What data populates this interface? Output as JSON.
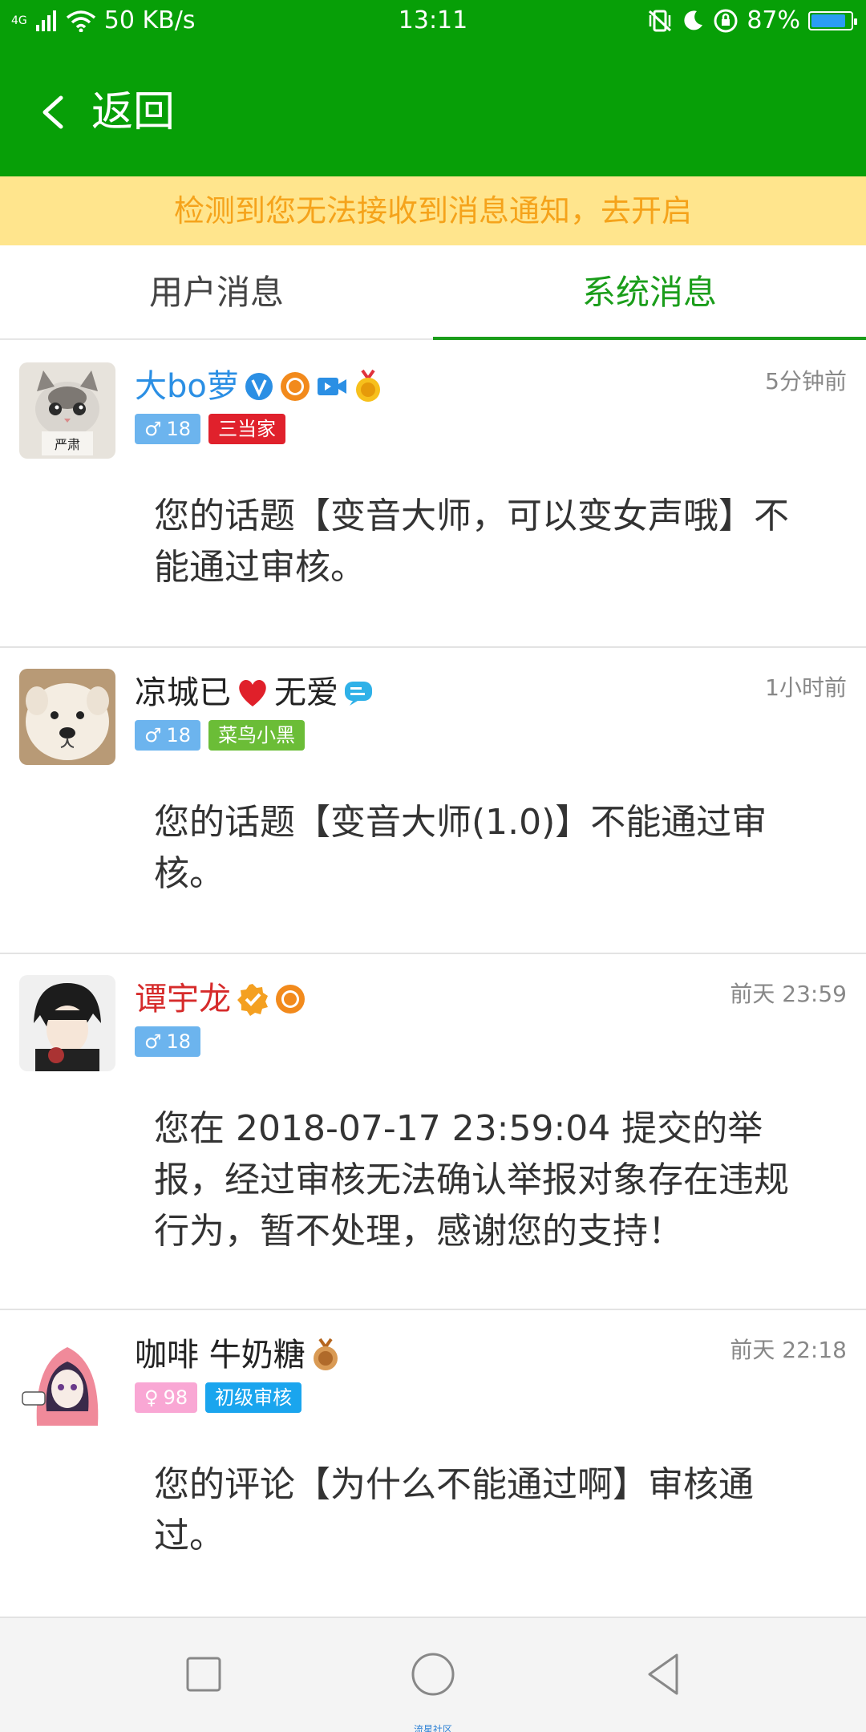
{
  "status_bar": {
    "network": "4G",
    "speed": "50 KB/s",
    "time": "13:11",
    "battery_text": "87%",
    "battery_level": 0.87
  },
  "app_bar": {
    "back_label": "返回"
  },
  "notice": {
    "text": "检测到您无法接收到消息通知，去开启"
  },
  "tabs": {
    "user": "用户消息",
    "system": "系统消息",
    "active": "system"
  },
  "messages": [
    {
      "name": "大bo萝",
      "name_color": "#2b8fe4",
      "time": "5分钟前",
      "gender": "male",
      "age": "18",
      "role": "三当家",
      "avatar_label": "严肃",
      "content": "您的话题【变音大师，可以变女声哦】不能通过审核。"
    },
    {
      "name_part1": "凉城已",
      "name_part2": "无爱",
      "name_color": "#222222",
      "time": "1小时前",
      "gender": "male",
      "age": "18",
      "role": "菜鸟小黑",
      "content": "您的话题【变音大师(1.0)】不能通过审核。"
    },
    {
      "name": "谭宇龙",
      "name_color": "#d62b2b",
      "time": "前天 23:59",
      "gender": "male",
      "age": "18",
      "content": "您在 2018-07-17 23:59:04 提交的举报，经过审核无法确认举报对象存在违规行为，暂不处理，感谢您的支持！"
    },
    {
      "name": "咖啡 牛奶糖",
      "name_color": "#222222",
      "time": "前天 22:18",
      "gender": "female",
      "age": "98",
      "role": "初级审核",
      "content": "您的评论【为什么不能通过啊】审核通过。"
    }
  ],
  "nav_caption": "流星社区"
}
